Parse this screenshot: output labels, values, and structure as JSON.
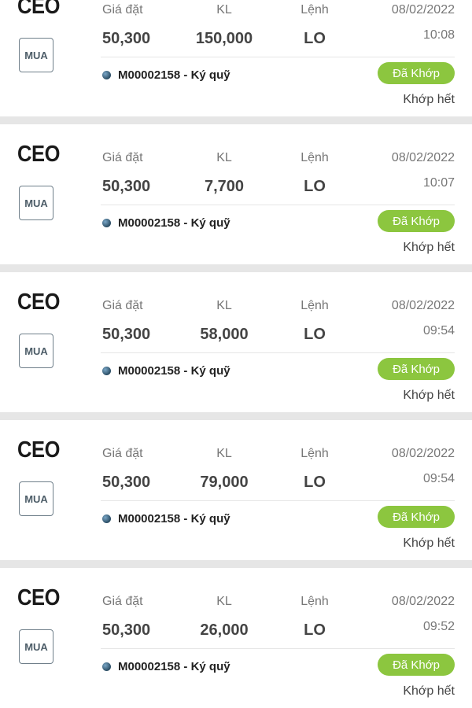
{
  "headers": {
    "price": "Giá đặt",
    "qty": "KL",
    "order": "Lệnh"
  },
  "colors": {
    "status_pill": "#8cc63f",
    "separator": "#e6e6e6"
  },
  "orders": [
    {
      "ticker": "CEO",
      "side": "MUA",
      "price": "50,300",
      "qty": "150,000",
      "order_type": "LO",
      "account": "M00002158 - Ký quỹ",
      "date": "08/02/2022",
      "time": "10:08",
      "status": "Đã Khớp",
      "fill": "Khớp hết"
    },
    {
      "ticker": "CEO",
      "side": "MUA",
      "price": "50,300",
      "qty": "7,700",
      "order_type": "LO",
      "account": "M00002158 - Ký quỹ",
      "date": "08/02/2022",
      "time": "10:07",
      "status": "Đã Khớp",
      "fill": "Khớp hết"
    },
    {
      "ticker": "CEO",
      "side": "MUA",
      "price": "50,300",
      "qty": "58,000",
      "order_type": "LO",
      "account": "M00002158 - Ký quỹ",
      "date": "08/02/2022",
      "time": "09:54",
      "status": "Đã Khớp",
      "fill": "Khớp hết"
    },
    {
      "ticker": "CEO",
      "side": "MUA",
      "price": "50,300",
      "qty": "79,000",
      "order_type": "LO",
      "account": "M00002158 - Ký quỹ",
      "date": "08/02/2022",
      "time": "09:54",
      "status": "Đã Khớp",
      "fill": "Khớp hết"
    },
    {
      "ticker": "CEO",
      "side": "MUA",
      "price": "50,300",
      "qty": "26,000",
      "order_type": "LO",
      "account": "M00002158 - Ký quỹ",
      "date": "08/02/2022",
      "time": "09:52",
      "status": "Đã Khớp",
      "fill": "Khớp hết"
    }
  ]
}
